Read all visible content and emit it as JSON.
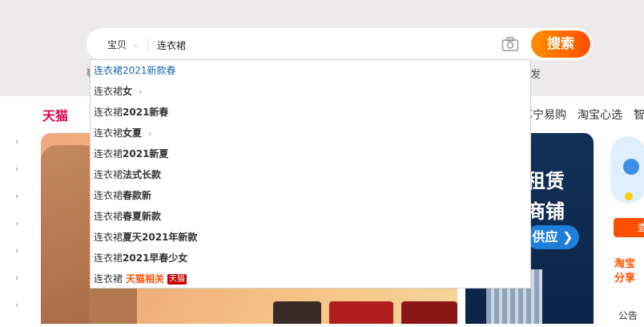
{
  "search": {
    "category": "宝贝",
    "value": "连衣裙",
    "button_label": "搜索",
    "hint_left": "鞋",
    "hint_right": "发"
  },
  "nav": {
    "tmall": "天猫",
    "links": [
      "苏宁易购",
      "淘宝心选",
      "智"
    ]
  },
  "suggestions": [
    {
      "prefix": "连衣裙",
      "rest": "2021新款春",
      "has_arrow": false
    },
    {
      "prefix": "连衣裙",
      "rest": "女",
      "has_arrow": true
    },
    {
      "prefix": "连衣裙",
      "rest": "2021新春",
      "has_arrow": false
    },
    {
      "prefix": "连衣裙",
      "rest": "女夏",
      "has_arrow": true
    },
    {
      "prefix": "连衣裙",
      "rest": "2021新夏",
      "has_arrow": false
    },
    {
      "prefix": "连衣裙",
      "rest": "法式长款",
      "has_arrow": false
    },
    {
      "prefix": "连衣裙",
      "rest": "春款新",
      "has_arrow": false
    },
    {
      "prefix": "连衣裙",
      "rest": "春夏新款",
      "has_arrow": false
    },
    {
      "prefix": "连衣裙",
      "rest": "夏天2021年新款",
      "has_arrow": false
    },
    {
      "prefix": "连衣裙",
      "rest": "2021早春少女",
      "has_arrow": false
    }
  ],
  "tmall_suggestion": {
    "prefix": "连衣裙",
    "label": "天猫相关",
    "badge": "天猫"
  },
  "banner_mid": {
    "line1": "租赁",
    "line2": "商铺",
    "pill": "供应 ❯"
  },
  "right_col": {
    "button": "查",
    "text1": "淘宝",
    "text2": "分享",
    "notice": "公告"
  },
  "colors": {
    "accent": "#ff5000",
    "tmall": "#e0004c",
    "first_suggestion": "#1a66b3"
  }
}
